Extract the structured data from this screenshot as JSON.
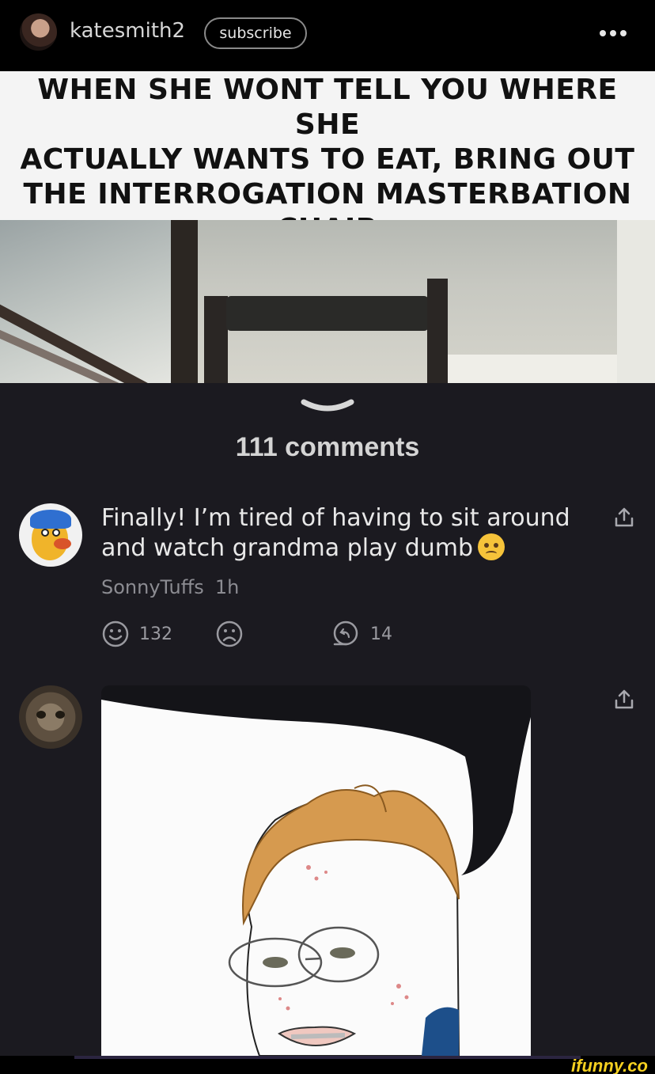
{
  "header": {
    "username": "katesmith2",
    "subscribe_label": "subscribe",
    "more_icon": "more-dots-icon"
  },
  "post": {
    "caption_line1": "WHEN SHE WONT TELL YOU WHERE SHE",
    "caption_line2": "ACTUALLY WANTS TO EAT, BRING OUT",
    "caption_line3": "THE INTERROGATION MASTERBATION",
    "caption_line4": "CHAIR"
  },
  "comments_header": {
    "label": "111 comments"
  },
  "comments": [
    {
      "text": "Finally! I’m tired of having to sit around and watch grandma play dumb",
      "emoji": "angry-face",
      "author": "SonnyTuffs",
      "time": "1h",
      "likes": "132",
      "replies": "14"
    },
    {
      "type": "image"
    }
  ],
  "watermark": "ifunny.co",
  "colors": {
    "background": "#1b1a20",
    "header": "#000000",
    "text": "#e8e8e8",
    "muted": "#8c8c92",
    "watermark": "#f5d020"
  }
}
